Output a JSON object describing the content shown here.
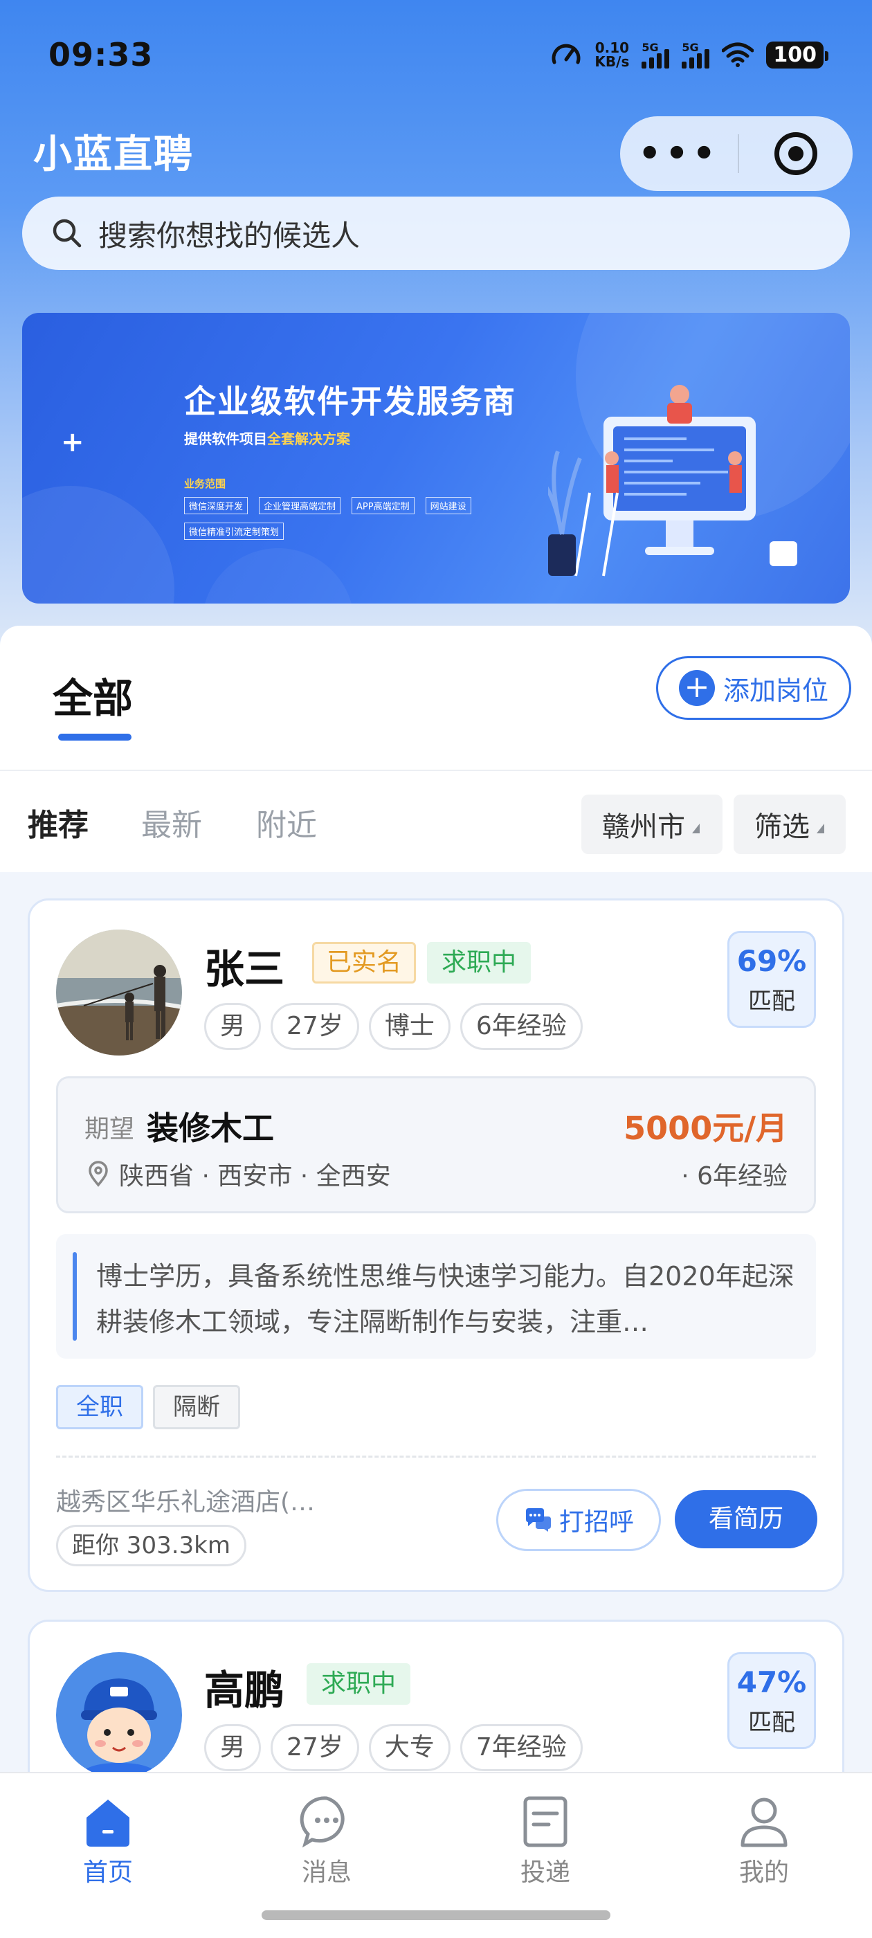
{
  "status": {
    "time": "09:33",
    "speed_value": "0.10",
    "speed_unit": "KB/s",
    "net1": "5G",
    "net2": "5G",
    "battery": "100"
  },
  "header": {
    "title": "小蓝直聘",
    "more": "•••"
  },
  "search": {
    "placeholder": "搜索你想找的候选人"
  },
  "banner": {
    "title": "企业级软件开发服务商",
    "subtitle_prefix": "提供软件项目",
    "subtitle_highlight": "全套解决方案",
    "scope_label": "业务范围",
    "services": [
      "微信深度开发",
      "企业管理高端定制",
      "APP高端定制",
      "网站建设",
      "微信精准引流定制策划"
    ]
  },
  "tabs": {
    "all": "全部",
    "add_position": "添加岗位"
  },
  "filters": {
    "recommend": "推荐",
    "latest": "最新",
    "nearby": "附近",
    "city": "赣州市",
    "filter": "筛选"
  },
  "candidates": [
    {
      "name": "张三",
      "verified": "已实名",
      "status": "求职中",
      "chips": [
        "男",
        "27岁",
        "博士",
        "6年经验"
      ],
      "match_pct": "69%",
      "match_label": "匹配",
      "expect_label": "期望",
      "job": "装修木工",
      "salary": "5000元/月",
      "location": "陕西省 · 西安市 · 全西安",
      "experience": "· 6年经验",
      "description": "博士学历，具备系统性思维与快速学习能力。自2020年起深耕装修木工领域，专注隔断制作与安装，注重…",
      "tags": [
        "全职",
        "隔断"
      ],
      "address": "越秀区华乐礼途酒店(…",
      "distance": "距你 303.3km",
      "greet": "打招呼",
      "resume": "看简历"
    },
    {
      "name": "高鹏",
      "status": "求职中",
      "chips": [
        "男",
        "27岁",
        "大专",
        "7年经验"
      ],
      "match_pct": "47%",
      "match_label": "匹配"
    }
  ],
  "tabbar": [
    {
      "label": "首页",
      "icon": "home-icon",
      "active": true
    },
    {
      "label": "消息",
      "icon": "message-icon",
      "active": false
    },
    {
      "label": "投递",
      "icon": "document-icon",
      "active": false
    },
    {
      "label": "我的",
      "icon": "profile-icon",
      "active": false
    }
  ],
  "colors": {
    "primary": "#2f6fe8",
    "salary": "#e0662b",
    "seeking": "#2eaa55",
    "verified": "#e39a22"
  }
}
